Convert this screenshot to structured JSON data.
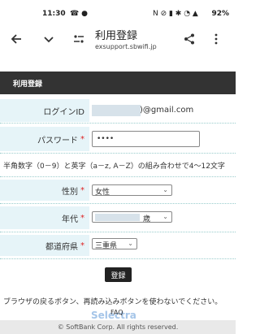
{
  "status_bar": {
    "time": "11:30",
    "battery": "92%"
  },
  "browser": {
    "title": "利用登録",
    "url": "exsupport.sbwifi.jp"
  },
  "form": {
    "header": "利用登録",
    "login_id": {
      "label": "ログインID",
      "required": "*",
      "value_suffix": ")@gmail.com"
    },
    "password": {
      "label": "パスワード",
      "required": "*",
      "value": "••••"
    },
    "password_note": "半角数字（0－9）と英字（a－z, A－Z）の組み合わせで4〜12文字",
    "gender": {
      "label": "性別",
      "required": "*",
      "value": "女性"
    },
    "age": {
      "label": "年代",
      "required": "*",
      "suffix": "歳"
    },
    "prefecture": {
      "label": "都道府県",
      "required": "*",
      "value": "三重県"
    },
    "submit": "登録"
  },
  "notice": "ブラウザの戻るボタン、再読み込みボタンを使わないでください。",
  "faq": "FAQ",
  "watermark": "Selectra",
  "footer": "© SoftBank Corp.  All rights reserved."
}
